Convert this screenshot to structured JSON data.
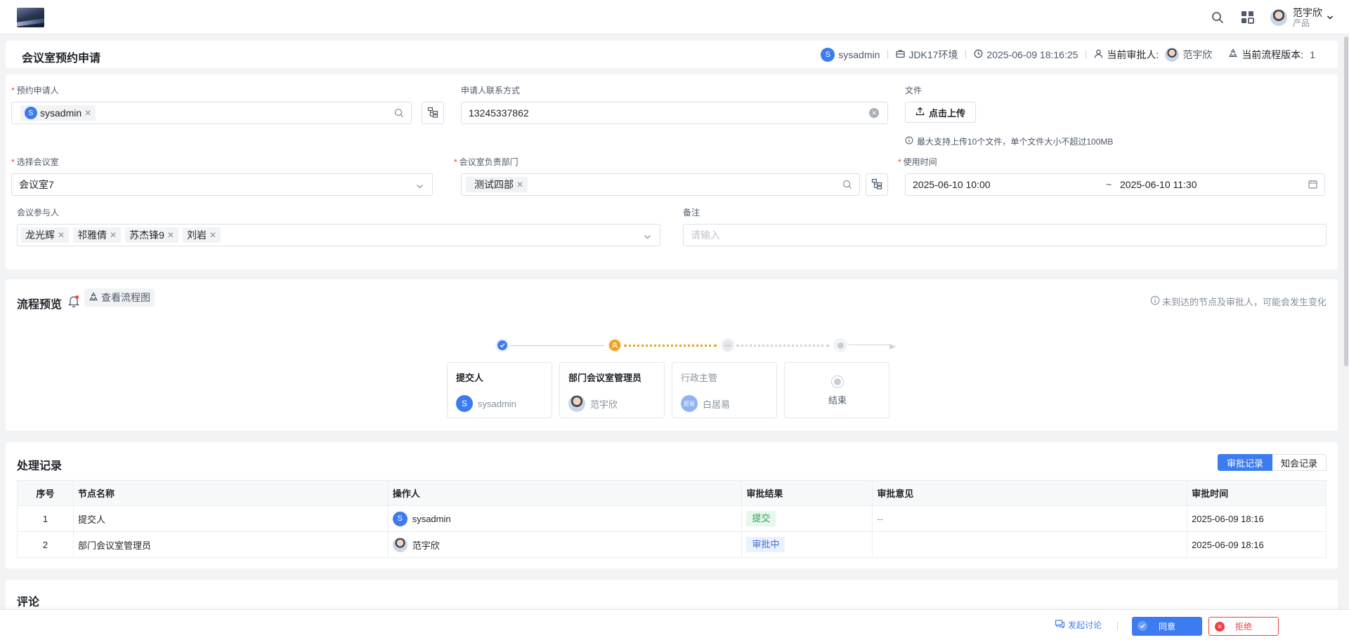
{
  "topbar": {
    "user_name": "范宇欣",
    "user_role": "产品",
    "icons": [
      "search-icon",
      "apps-grid-icon",
      "chevron-down-icon"
    ]
  },
  "header": {
    "title": "会议室预约申请",
    "meta": {
      "creator_initial": "S",
      "creator": "sysadmin",
      "environment": "JDK17环境",
      "datetime": "2025-06-09 18:16:25",
      "approver_label": "当前审批人:",
      "approver": "范宇欣",
      "version_label": "当前流程版本:",
      "version": "1"
    }
  },
  "form": {
    "applicant": {
      "label": "预约申请人",
      "tag_initial": "S",
      "tag": "sysadmin"
    },
    "contact": {
      "label": "申请人联系方式",
      "value": "13245337862"
    },
    "file": {
      "label": "文件",
      "button": "点击上传",
      "hint": "最大支持上传10个文件，单个文件大小不超过100MB"
    },
    "room": {
      "label": "选择会议室",
      "value": "会议室7"
    },
    "dept": {
      "label": "会议室负责部门",
      "tag": "测试四部"
    },
    "time": {
      "label": "使用时间",
      "start": "2025-06-10 10:00",
      "sep": "~",
      "end": "2025-06-10 11:30"
    },
    "participants": {
      "label": "会议参与人",
      "tags": [
        "龙光辉",
        "祁雅倩",
        "苏杰锋9",
        "刘岩"
      ]
    },
    "remark": {
      "label": "备注",
      "placeholder": "请输入"
    }
  },
  "flow": {
    "title": "流程预览",
    "view_button": "查看流程图",
    "hint": "未到达的节点及审批人，可能会发生变化",
    "nodes": [
      {
        "title": "提交人",
        "user": "sysadmin",
        "user_initial": "S",
        "status": "done"
      },
      {
        "title": "部门会议室管理员",
        "user": "范宇欣",
        "status": "current"
      },
      {
        "title": "行政主管",
        "user": "白居易",
        "user_initial": "居易",
        "status": "pending"
      },
      {
        "title": "结束",
        "status": "end"
      }
    ]
  },
  "records": {
    "title": "处理记录",
    "tabs": [
      "审批记录",
      "知会记录"
    ],
    "columns": [
      "序号",
      "节点名称",
      "操作人",
      "审批结果",
      "审批意见",
      "审批时间"
    ],
    "rows": [
      {
        "no": "1",
        "node": "提交人",
        "operator": "sysadmin",
        "operator_initial": "S",
        "result": "提交",
        "opinion": "--",
        "time": "2025-06-09 18:16"
      },
      {
        "no": "2",
        "node": "部门会议室管理员",
        "operator": "范宇欣",
        "result": "审批中",
        "opinion": "",
        "time": "2025-06-09 18:16"
      }
    ]
  },
  "comments": {
    "title": "评论"
  },
  "actions": {
    "discuss": "发起讨论",
    "approve": "同意",
    "reject": "拒绝"
  },
  "colors": {
    "primary": "#3c7cf0",
    "danger": "#f53f3f",
    "warning": "#f0a020",
    "success_bg": "#e8f7ec",
    "success_text": "#2f9e5a",
    "info_bg": "#eaf1ff",
    "info_text": "#3c6fd6"
  }
}
